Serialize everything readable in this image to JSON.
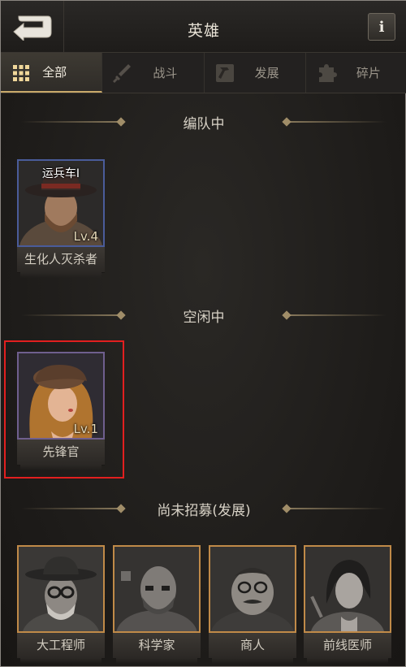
{
  "header": {
    "title": "英雄",
    "info_label": "i"
  },
  "tabs": [
    {
      "label": "全部",
      "icon": "grid-icon",
      "active": true
    },
    {
      "label": "战斗",
      "icon": "dagger-icon",
      "active": false
    },
    {
      "label": "发展",
      "icon": "hammer-icon",
      "active": false
    },
    {
      "label": "碎片",
      "icon": "puzzle-icon",
      "active": false
    }
  ],
  "sections": {
    "in_team": {
      "title": "编队中",
      "heroes": [
        {
          "name": "生化人灭杀者",
          "level": "Lv.4",
          "tag": "运兵车I"
        }
      ]
    },
    "idle": {
      "title": "空闲中",
      "heroes": [
        {
          "name": "先锋官",
          "level": "Lv.1"
        }
      ]
    },
    "not_recruited": {
      "title": "尚未招募(发展)",
      "heroes": [
        {
          "name": "大工程师"
        },
        {
          "name": "科学家"
        },
        {
          "name": "商人"
        },
        {
          "name": "前线医师"
        }
      ]
    }
  },
  "colors": {
    "accent_gold": "#c9a96a",
    "selection_red": "#e21f1f",
    "purple_frame": "#6f5f8e",
    "orange_frame": "#c08a48"
  }
}
